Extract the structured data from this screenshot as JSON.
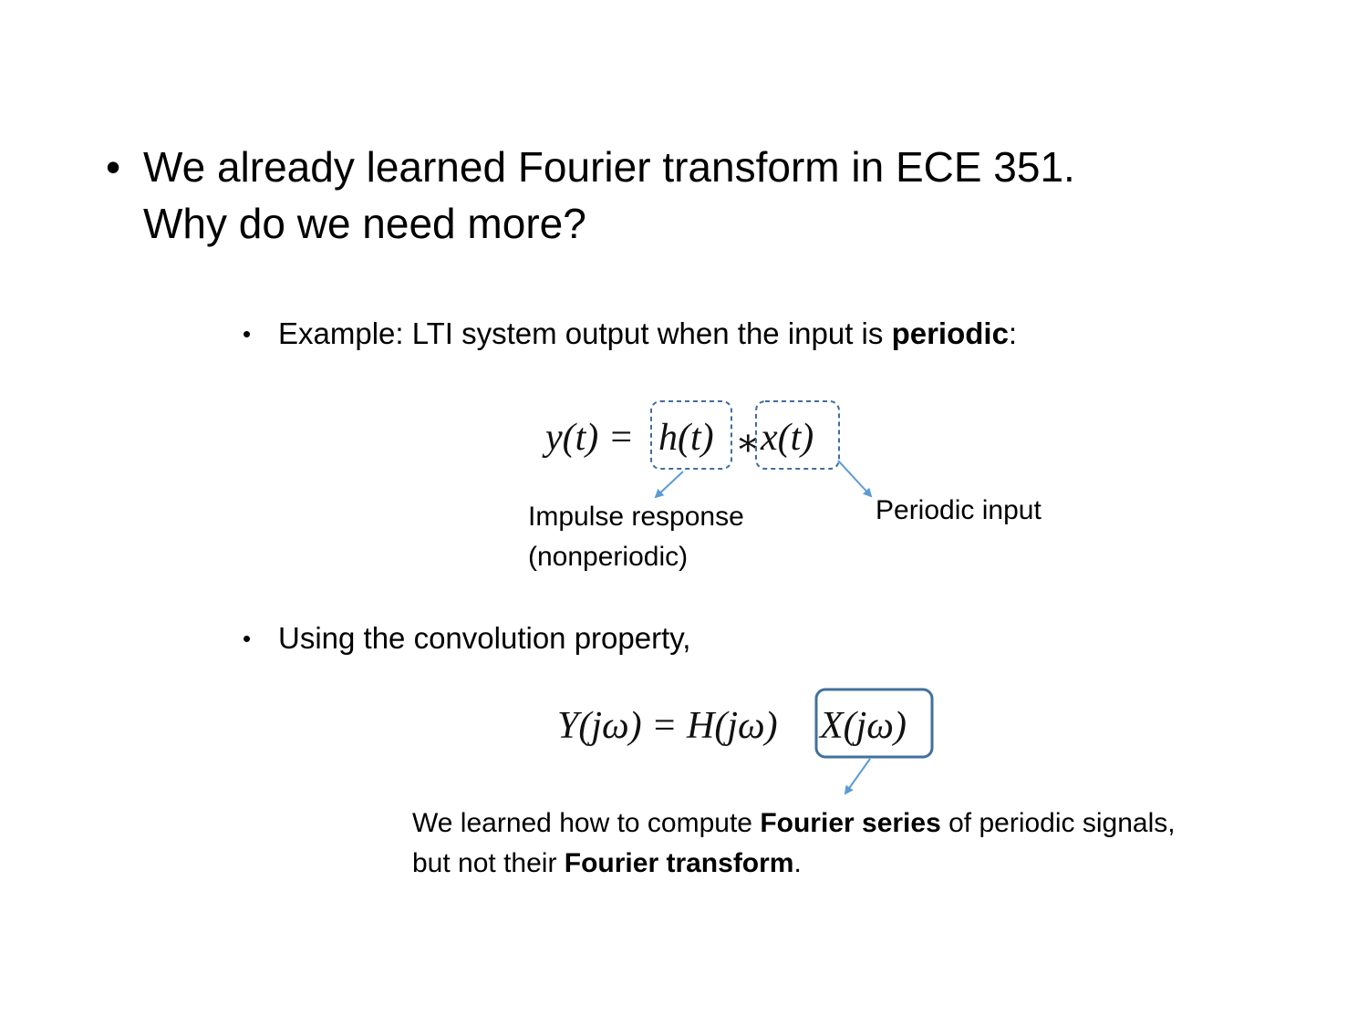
{
  "slide": {
    "main_bullet": {
      "line1": "We already learned Fourier transform in ECE 351.",
      "line2": "Why do we need more?"
    },
    "example_bullet": {
      "prefix": "Example: LTI system output when the input is ",
      "bold": "periodic",
      "suffix": ":"
    },
    "equation1": {
      "lhs": "y(t) =",
      "h_term": "h(t)",
      "operator": "∗",
      "x_term": "x(t)"
    },
    "label_impulse": {
      "line1": "Impulse response",
      "line2": "(nonperiodic)"
    },
    "label_periodic": "Periodic input",
    "convolution_bullet": "Using the convolution property,",
    "equation2": {
      "lhs": "Y(jω) = H(jω)",
      "boxed": "X(jω)"
    },
    "note": {
      "part1": "We learned how to compute ",
      "bold1": "Fourier series",
      "part2": " of periodic signals,",
      "part3": "but not their ",
      "bold2": "Fourier transform",
      "part4": "."
    },
    "colors": {
      "dashed_box": "#3f6e9e",
      "solid_box": "#41719c",
      "arrow": "#5b9bd5"
    }
  }
}
